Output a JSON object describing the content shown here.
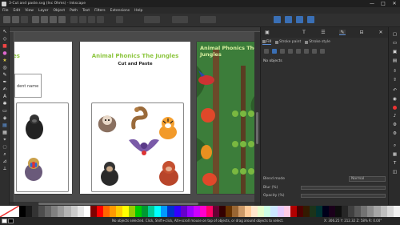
{
  "window": {
    "title": "3-Cut and paste.svg (Inc Ohms) - Inkscape",
    "controls": [
      "—",
      "□",
      "✕"
    ]
  },
  "menu": [
    "File",
    "Edit",
    "View",
    "Layer",
    "Object",
    "Path",
    "Text",
    "Filters",
    "Extensions",
    "Help"
  ],
  "pages": [
    {
      "title": "Animal Phonics The Jungles",
      "subtitle": "Cut and Paste",
      "name_label": "Student name"
    }
  ],
  "left_page": {
    "title_fragment": "Jungles",
    "name_fragment": "dent name"
  },
  "panel": {
    "tabs": [
      "fill-stroke-icon",
      "text-icon",
      "layers-icon",
      "xml-icon",
      "align-icon"
    ],
    "subtabs": [
      "Fill",
      "Stroke paint",
      "Stroke style"
    ],
    "no_objects": "No objects",
    "blend_label": "Blend mode",
    "blend_value": "Normal",
    "blur_label": "Blur (%)",
    "opacity_label": "Opacity (%)"
  },
  "status": {
    "message": "No objects selected. Click, Shift+click, Alt+scroll mouse on top of objects, or drag around objects to select.",
    "x_label": "X:",
    "x_value": "306.25",
    "y_label": "Y:",
    "y_value": "212.32",
    "zoom_label": "Z:",
    "zoom_value": "58%",
    "rotation_label": "R:",
    "rotation_value": "0.00°"
  },
  "colors": {
    "title_green": "#8dc63f",
    "bg_dark": "#2e2e2e",
    "accent_blue": "#3a6fb5"
  },
  "palette": [
    "#000000",
    "#1a1a1a",
    "#333333",
    "#4d4d4d",
    "#666666",
    "#808080",
    "#999999",
    "#b3b3b3",
    "#cccccc",
    "#e6e6e6",
    "#ffffff",
    "#800000",
    "#ff0000",
    "#ff6600",
    "#ff9900",
    "#ffcc00",
    "#ffff00",
    "#99cc00",
    "#00cc00",
    "#009933",
    "#00cc99",
    "#00ffff",
    "#0099ff",
    "#0033cc",
    "#3300ff",
    "#6600cc",
    "#9900ff",
    "#cc00ff",
    "#ff00cc",
    "#ff0066",
    "#660033",
    "#330000",
    "#663300",
    "#996633",
    "#cc9966",
    "#ffcc99",
    "#ffe6cc",
    "#e6ffcc",
    "#ccffe6",
    "#cce6ff",
    "#e6ccff",
    "#ffcce6",
    "#b30000",
    "#4d0000",
    "#331a00",
    "#1a331a",
    "#003333",
    "#00001a",
    "#1a001a",
    "#0d0d0d",
    "#262626",
    "#404040",
    "#595959",
    "#737373",
    "#8c8c8c",
    "#a6a6a6",
    "#bfbfbf",
    "#d9d9d9",
    "#f2f2f2"
  ]
}
